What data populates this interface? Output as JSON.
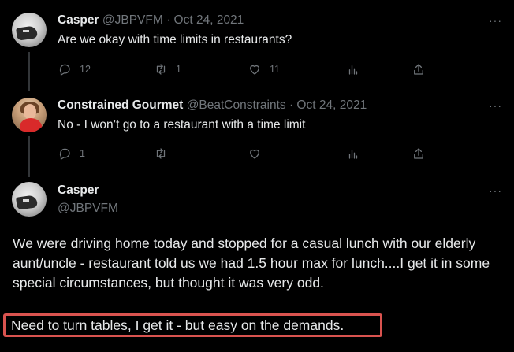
{
  "tweets": [
    {
      "name": "Casper",
      "handle": "@JBPVFM",
      "date": "· Oct 24, 2021",
      "text": "Are we okay with time limits in restaurants?",
      "reply_count": "12",
      "retweet_count": "1",
      "like_count": "11",
      "views_count": "",
      "more": "···"
    },
    {
      "name": "Constrained Gourmet",
      "handle": "@BeatConstraints",
      "date": "· Oct 24, 2021",
      "text": "No - I won’t go to a restaurant with a time limit",
      "reply_count": "1",
      "retweet_count": "",
      "like_count": "",
      "views_count": "",
      "more": "···"
    }
  ],
  "main_tweet": {
    "name": "Casper",
    "handle": "@JBPVFM",
    "more": "···",
    "paragraph1": "We were driving home today and stopped for a casual lunch with our elderly aunt/uncle - restaurant told us we had 1.5 hour max for lunch....I get it in some special circumstances, but thought it was very odd.",
    "paragraph2": "Need to turn tables, I get it - but easy on the demands."
  },
  "icons": {
    "reply": "reply-icon",
    "retweet": "retweet-icon",
    "like": "heart-icon",
    "views": "views-icon",
    "share": "share-icon"
  },
  "colors": {
    "background": "#000000",
    "text": "#e7e9ea",
    "muted": "#71767b",
    "highlight_border": "#d9534f"
  }
}
